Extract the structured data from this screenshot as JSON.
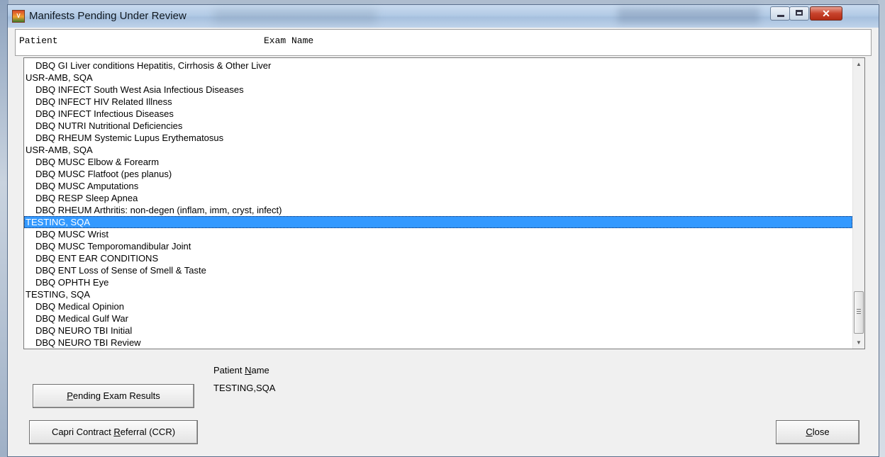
{
  "window": {
    "title": "Manifests Pending Under Review",
    "icon_name": "capri-app-icon",
    "controls": {
      "minimize": "minimize-icon",
      "maximize": "maximize-icon",
      "close": "close-icon"
    }
  },
  "columns": {
    "patient": "Patient",
    "exam_name": "Exam Name"
  },
  "list": {
    "rows": [
      {
        "type": "exam",
        "text": "DBQ GI Liver conditions Hepatitis, Cirrhosis & Other Liver"
      },
      {
        "type": "patient",
        "text": "USR-AMB, SQA"
      },
      {
        "type": "exam",
        "text": "DBQ INFECT South West Asia Infectious Diseases"
      },
      {
        "type": "exam",
        "text": "DBQ INFECT HIV Related Illness"
      },
      {
        "type": "exam",
        "text": "DBQ INFECT Infectious Diseases"
      },
      {
        "type": "exam",
        "text": "DBQ NUTRI Nutritional Deficiencies"
      },
      {
        "type": "exam",
        "text": "DBQ RHEUM Systemic Lupus Erythematosus"
      },
      {
        "type": "patient",
        "text": "USR-AMB, SQA"
      },
      {
        "type": "exam",
        "text": "DBQ MUSC Elbow & Forearm"
      },
      {
        "type": "exam",
        "text": "DBQ MUSC Flatfoot (pes planus)"
      },
      {
        "type": "exam",
        "text": "DBQ MUSC Amputations"
      },
      {
        "type": "exam",
        "text": "DBQ RESP Sleep Apnea"
      },
      {
        "type": "exam",
        "text": "DBQ RHEUM Arthritis: non-degen (inflam, imm, cryst, infect)"
      },
      {
        "type": "patient",
        "text": "TESTING, SQA",
        "selected": true
      },
      {
        "type": "exam",
        "text": "DBQ MUSC Wrist"
      },
      {
        "type": "exam",
        "text": "DBQ MUSC Temporomandibular Joint"
      },
      {
        "type": "exam",
        "text": "DBQ ENT EAR CONDITIONS"
      },
      {
        "type": "exam",
        "text": "DBQ ENT Loss of Sense of Smell & Taste"
      },
      {
        "type": "exam",
        "text": "DBQ OPHTH Eye"
      },
      {
        "type": "patient",
        "text": "TESTING, SQA"
      },
      {
        "type": "exam",
        "text": "DBQ Medical Opinion"
      },
      {
        "type": "exam",
        "text": "DBQ Medical Gulf War"
      },
      {
        "type": "exam",
        "text": "DBQ NEURO TBI Initial"
      },
      {
        "type": "exam",
        "text": "DBQ NEURO TBI Review"
      }
    ]
  },
  "patient_name": {
    "label_pre": "Patient ",
    "label_key": "N",
    "label_post": "ame",
    "value": "TESTING,SQA"
  },
  "buttons": {
    "pending": {
      "key": "P",
      "rest": "ending Exam Results"
    },
    "ccr": {
      "pre": "Capri Contract ",
      "key": "R",
      "post": "eferral (CCR)"
    },
    "close": {
      "key": "C",
      "rest": "lose"
    }
  },
  "colors": {
    "selection": "#3399ff",
    "window_bg": "#f0f0f0"
  }
}
